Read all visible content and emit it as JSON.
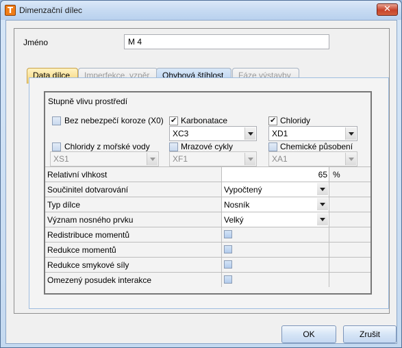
{
  "window": {
    "title": "Dimenzační dílec",
    "close_label": "✕",
    "app_icon_letter": "T"
  },
  "name_field": {
    "label": "Jméno",
    "value": "M 4"
  },
  "tabs": [
    {
      "label": "Data dílce",
      "state": "active"
    },
    {
      "label": "Imperfekce, vzpěr",
      "state": "disabled"
    },
    {
      "label": "Ohybová štíhlost",
      "state": "enabled"
    },
    {
      "label": "Fáze výstavby",
      "state": "disabled"
    }
  ],
  "environment": {
    "section_title": "Stupně vlivu prostředí",
    "no_corrosion": {
      "label": "Bez nebezpečí koroze (X0)",
      "checked": false
    },
    "carbonation": {
      "label": "Karbonatace",
      "checked": true,
      "value": "XC3"
    },
    "chlorides": {
      "label": "Chloridy",
      "checked": true,
      "value": "XD1"
    },
    "sea_chlorides": {
      "label": "Chloridy z mořské vody",
      "checked": false,
      "value": "XS1"
    },
    "freeze": {
      "label": "Mrazové cykly",
      "checked": false,
      "value": "XF1"
    },
    "chemical": {
      "label": "Chemické působení",
      "checked": false,
      "value": "XA1"
    }
  },
  "properties": {
    "humidity": {
      "label": "Relativní vlhkost",
      "value": "65",
      "unit": "%"
    },
    "curing": {
      "label": "Součinitel dotvarování",
      "value": "Vypočtený"
    },
    "member_type": {
      "label": "Typ dílce",
      "value": "Nosník"
    },
    "importance": {
      "label": "Význam nosného prvku",
      "value": "Velký"
    },
    "moment_redistribution": {
      "label": "Redistribuce momentů"
    },
    "moment_reduction": {
      "label": "Redukce momentů"
    },
    "shear_reduction": {
      "label": "Redukce smykové síly"
    },
    "limited_interaction": {
      "label": "Omezený posudek interakce"
    }
  },
  "buttons": {
    "ok": "OK",
    "cancel": "Zrušit"
  }
}
